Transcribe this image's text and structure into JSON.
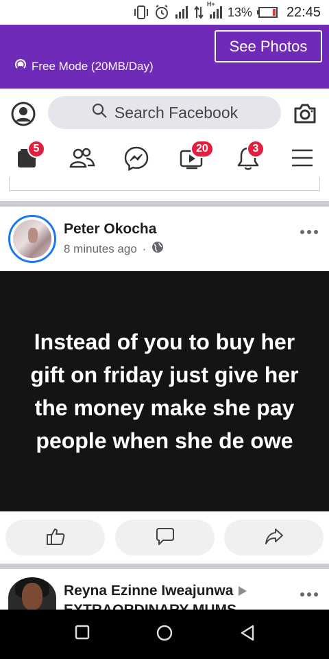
{
  "status_bar": {
    "battery_percent": "13%",
    "time": "22:45",
    "network_label": "H+",
    "icons": [
      "vibrate-icon",
      "alarm-icon",
      "signal-icon",
      "data-arrows-icon",
      "signal-icon",
      "battery-icon"
    ]
  },
  "free_mode": {
    "label": "Free Mode (20MB/Day)",
    "button": "See Photos",
    "color": "#6f2bb8"
  },
  "search": {
    "placeholder": "Search Facebook"
  },
  "nav": {
    "items": [
      {
        "icon": "feed-icon",
        "badge": "5"
      },
      {
        "icon": "friends-icon",
        "badge": ""
      },
      {
        "icon": "messenger-icon",
        "badge": ""
      },
      {
        "icon": "watch-icon",
        "badge": "20"
      },
      {
        "icon": "bell-icon",
        "badge": "3"
      },
      {
        "icon": "menu-icon",
        "badge": ""
      }
    ],
    "badge_color": "#e41e3f"
  },
  "post": {
    "author": "Peter Okocha",
    "time": "8 minutes ago",
    "separator": "·",
    "text": "Instead of you to buy her gift on friday just give her the money make she pay people when she de owe",
    "actions": [
      "like-icon",
      "comment-icon",
      "share-icon"
    ]
  },
  "post2": {
    "author": "Reyna Ezinne Iweajunwa",
    "group": "EXTRAORDINARY MUMS"
  },
  "android_nav": [
    "recents-icon",
    "home-icon",
    "back-icon"
  ]
}
